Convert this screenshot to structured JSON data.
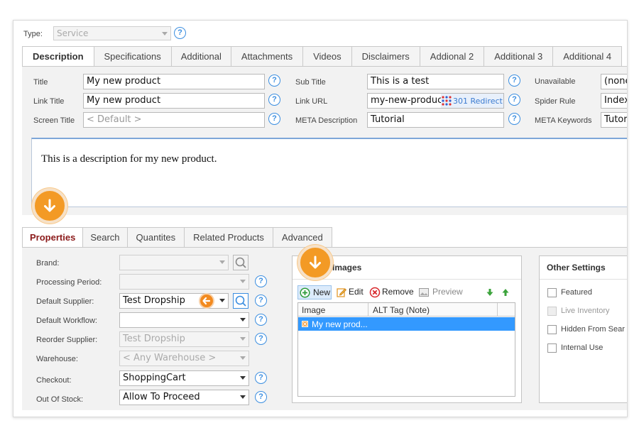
{
  "type_row": {
    "label": "Type:",
    "value": "Service"
  },
  "top_tabs": [
    "Description",
    "Specifications",
    "Additional",
    "Attachments",
    "Videos",
    "Disclaimers",
    "Addional 2",
    "Additional 3",
    "Additional 4"
  ],
  "fields": {
    "title": {
      "label": "Title",
      "value": "My new product"
    },
    "link_title": {
      "label": "Link Title",
      "value": "My new product"
    },
    "screen_title": {
      "label": "Screen Title",
      "placeholder": "< Default >"
    },
    "sub_title": {
      "label": "Sub Title",
      "value": "This is a test"
    },
    "link_url": {
      "label": "Link URL",
      "value": "my-new-product",
      "redirect": "301 Redirect"
    },
    "meta_description": {
      "label": "META Description",
      "value": "Tutorial"
    },
    "unavailable": {
      "label": "Unavailable",
      "value": "(none"
    },
    "spider_rule": {
      "label": "Spider Rule",
      "value": "Index"
    },
    "meta_keywords": {
      "label": "META Keywords",
      "value": "Tutor"
    }
  },
  "description_text": "This is a description for my new product.",
  "bottom_tabs": [
    "Properties",
    "Search",
    "Quantites",
    "Related Products",
    "Advanced"
  ],
  "properties": {
    "brand": {
      "label": "Brand:",
      "value": ""
    },
    "processing_period": {
      "label": "Processing Period:",
      "value": ""
    },
    "default_supplier": {
      "label": "Default Supplier:",
      "value": "Test Dropship"
    },
    "default_workflow": {
      "label": "Default Workflow:",
      "value": ""
    },
    "reorder_supplier": {
      "label": "Reorder Supplier:",
      "value": "Test Dropship"
    },
    "warehouse": {
      "label": "Warehouse:",
      "value": "< Any Warehouse >"
    },
    "checkout": {
      "label": "Checkout:",
      "value": "ShoppingCart"
    },
    "out_of_stock": {
      "label": "Out Of Stock:",
      "value": "Allow To Proceed"
    }
  },
  "images": {
    "title": "Images",
    "toolbar": {
      "new": "New",
      "edit": "Edit",
      "remove": "Remove",
      "preview": "Preview"
    },
    "columns": [
      "Image",
      "ALT Tag (Note)"
    ],
    "rows": [
      {
        "image": "My new prod...",
        "alt": ""
      }
    ]
  },
  "other_settings": {
    "title": "Other Settings",
    "items": [
      "Featured",
      "Live Inventory",
      "Hidden From Sear",
      "Internal Use"
    ]
  },
  "colors": {
    "accent_orange": "#f39a25",
    "help_blue": "#3b8ee0",
    "selection_blue": "#3399ff",
    "active_tab_red": "#8b1a1a"
  },
  "icons": {
    "help": "question-circle-icon",
    "search": "magnifier-icon",
    "down": "arrow-down-icon",
    "left": "arrow-left-icon"
  }
}
